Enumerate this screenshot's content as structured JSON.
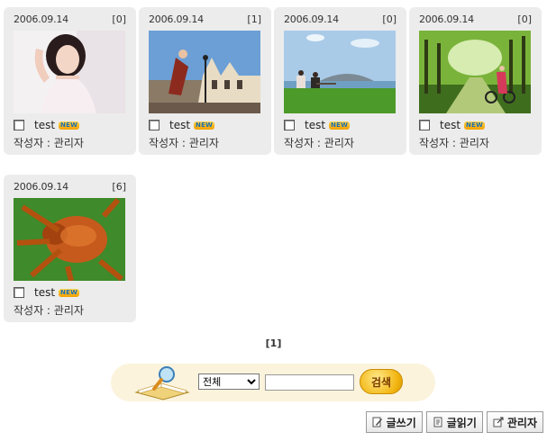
{
  "posts": [
    {
      "date": "2006.09.14",
      "comments": "[0]",
      "title": "test",
      "badge": "NEW",
      "author": "작성자 : 관리자",
      "image": "girl-portrait"
    },
    {
      "date": "2006.09.14",
      "comments": "[1]",
      "title": "test",
      "badge": "NEW",
      "author": "작성자 : 관리자",
      "image": "town-dancer"
    },
    {
      "date": "2006.09.14",
      "comments": "[0]",
      "title": "test",
      "badge": "NEW",
      "author": "작성자 : 관리자",
      "image": "seaside-couple"
    },
    {
      "date": "2006.09.14",
      "comments": "[0]",
      "title": "test",
      "badge": "NEW",
      "author": "작성자 : 관리자",
      "image": "forest-bicycle"
    },
    {
      "date": "2006.09.14",
      "comments": "[6]",
      "title": "test",
      "badge": "NEW",
      "author": "작성자 : 관리자",
      "image": "spider-macro"
    }
  ],
  "pagination": {
    "current": "[1]"
  },
  "search": {
    "scope_selected": "전체",
    "query": "",
    "button_label": "검색"
  },
  "actions": {
    "write_label": "글쓰기",
    "read_label": "글읽기",
    "admin_label": "관리자"
  }
}
